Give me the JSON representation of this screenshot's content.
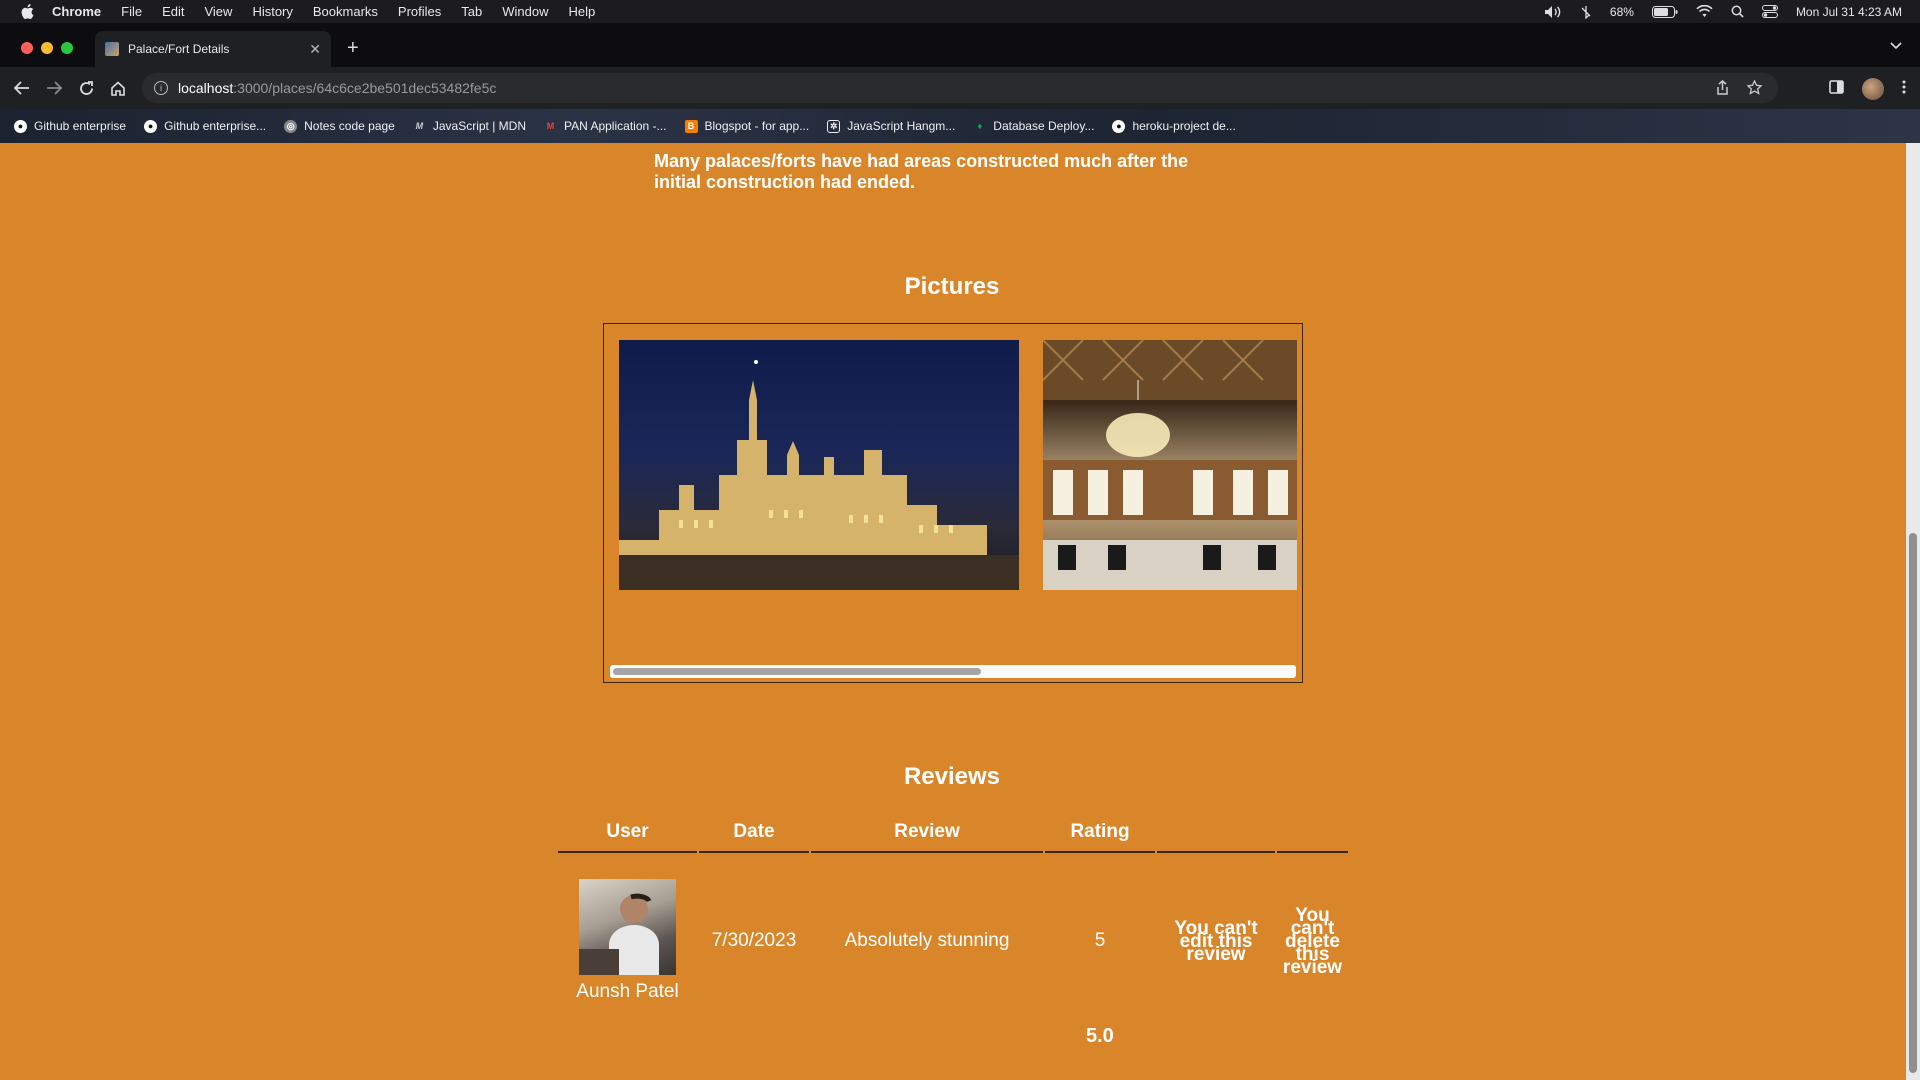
{
  "menubar": {
    "app": "Chrome",
    "items": [
      "File",
      "Edit",
      "View",
      "History",
      "Bookmarks",
      "Profiles",
      "Tab",
      "Window",
      "Help"
    ],
    "battery": "68%",
    "datetime": "Mon Jul 31  4:23 AM"
  },
  "tab": {
    "title": "Palace/Fort Details"
  },
  "address": {
    "host": "localhost",
    "path": ":3000/places/64c6ce2be501dec53482fe5c"
  },
  "bookmarks": [
    {
      "label": "Github enterprise",
      "icon": "github-icon"
    },
    {
      "label": "Github enterprise...",
      "icon": "github-icon"
    },
    {
      "label": "Notes code page",
      "icon": "globe-icon"
    },
    {
      "label": "JavaScript | MDN",
      "icon": "mdn-icon"
    },
    {
      "label": "PAN Application -...",
      "icon": "gmail-icon"
    },
    {
      "label": "Blogspot - for app...",
      "icon": "blogger-icon"
    },
    {
      "label": "JavaScript Hangm...",
      "icon": "openai-icon"
    },
    {
      "label": "Database Deploy...",
      "icon": "mongodb-icon"
    },
    {
      "label": "heroku-project de...",
      "icon": "github-icon"
    }
  ],
  "content": {
    "description": "Many palaces/forts have had areas constructed much after the initial construction had ended.",
    "pictures_title": "Pictures",
    "reviews_title": "Reviews",
    "table": {
      "headers": [
        "User",
        "Date",
        "Review",
        "Rating",
        "",
        ""
      ],
      "rows": [
        {
          "user": "Aunsh Patel",
          "date": "7/30/2023",
          "review": "Absolutely stunning",
          "rating": "5",
          "edit_note": "You can't edit this review",
          "delete_note": "You can't delete this review"
        }
      ]
    },
    "average_rating": "5.0"
  },
  "colors": {
    "page_bg": "#d9862b",
    "text": "#ffffff"
  }
}
